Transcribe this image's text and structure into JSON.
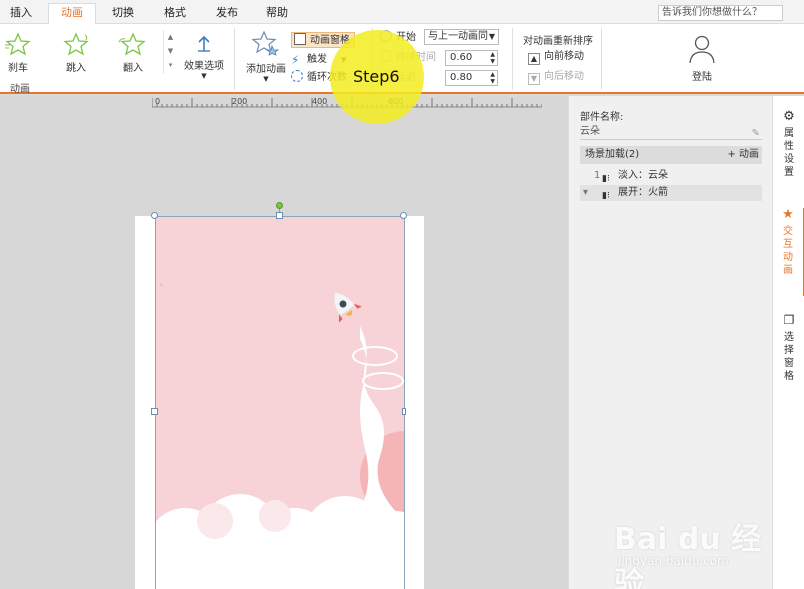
{
  "menu": {
    "items": [
      "插入",
      "动画",
      "切换",
      "格式",
      "发布",
      "帮助"
    ],
    "active": "动画",
    "tell_me": "告诉我们你想做什么？"
  },
  "ribbon": {
    "effects": [
      "刹车",
      "跳入",
      "翻入"
    ],
    "effect_options": "效果选项",
    "add_animation": "添加动画",
    "animation_pane": "动画窗格",
    "trigger": "触发",
    "loop_count": "循环次数",
    "group_label": "动画",
    "start_label": "开始",
    "start_value": "与上一动画同",
    "duration_label": "持续时间",
    "duration_value": "0.60",
    "delay_label": "延迟",
    "delay_value": "0.80",
    "reorder_title": "对动画重新排序",
    "move_forward": "向前移动",
    "move_backward": "向后移动",
    "login": "登陆",
    "step_label": "Step6"
  },
  "ruler": {
    "labels": [
      "0",
      "200",
      "400",
      "600"
    ]
  },
  "panel": {
    "component_name_label": "部件名称:",
    "component_name_value": "云朵",
    "scene_header": "场景加载(2)",
    "add_animation": "+ 动画",
    "animations": [
      {
        "num": "1",
        "text": "淡入：云朵"
      },
      {
        "num": "▾",
        "text": "展开：火箭"
      }
    ]
  },
  "sidetabs": [
    {
      "label": "属性设置"
    },
    {
      "label": "交互动画"
    },
    {
      "label": "选择窗格"
    }
  ],
  "watermark": {
    "main": "Bai du 经验",
    "sub": "jingyan.baidu.com"
  },
  "colors": {
    "accent": "#e8762c",
    "slide_bg": "#f7d2d6",
    "highlight": "#f2ec1e"
  }
}
